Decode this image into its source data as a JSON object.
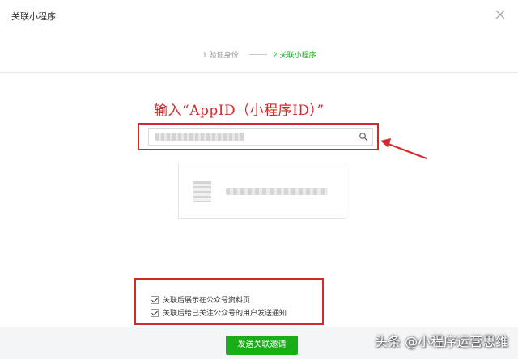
{
  "dialog": {
    "title": "关联小程序",
    "close_icon": "close-icon"
  },
  "steps": [
    {
      "label": "1.验证身份",
      "state": "done"
    },
    {
      "label": "2.关联小程序",
      "state": "active"
    }
  ],
  "colors": {
    "accent": "#1aad19",
    "annotation": "#d22b2b",
    "step_inactive": "#999999"
  },
  "annotation": {
    "text": "输入“AppID（小程序ID）”"
  },
  "search": {
    "value": "",
    "icon": "search-icon"
  },
  "result_card": {
    "name": ""
  },
  "options": [
    {
      "label": "关联后展示在公众号资料页",
      "checked": true
    },
    {
      "label": "关联后给已关注公众号的用户发送通知",
      "checked": true
    }
  ],
  "footer": {
    "send_label": "发送关联邀请"
  },
  "watermark": {
    "text": "头条 @小程序运营思维"
  }
}
